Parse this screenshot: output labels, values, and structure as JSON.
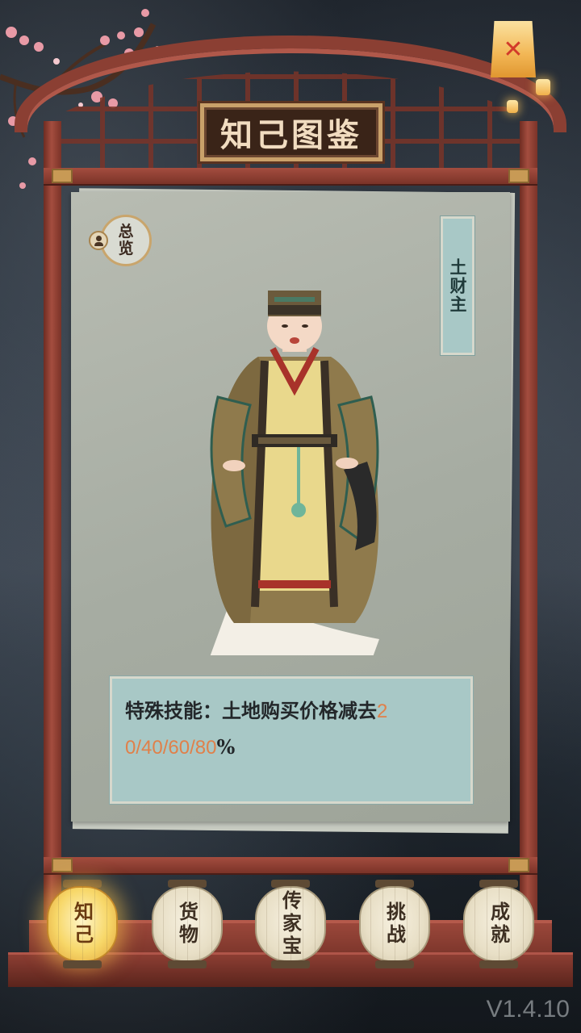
{
  "header": {
    "title": "知己图鉴"
  },
  "overview": {
    "label": "总览"
  },
  "character": {
    "name": "土财主"
  },
  "skill": {
    "line1_text": "特殊技能：土地购买价格减去",
    "line1_num": "2",
    "line2_num": "0/40/60/80",
    "line2_suffix": "%"
  },
  "tabs": [
    {
      "label": "知己",
      "active": true
    },
    {
      "label": "货物",
      "active": false
    },
    {
      "label": "传家宝",
      "active": false
    },
    {
      "label": "挑战",
      "active": false
    },
    {
      "label": "成就",
      "active": false
    }
  ],
  "version": "V1.4.10",
  "colors": {
    "frame": "#8b3f33",
    "paper": "#a6aca2",
    "accent_teal": "#a8c8c6",
    "highlight_number": "#e0804a",
    "active_lantern": "#f7d768"
  },
  "icons": {
    "close": "close-lantern-icon",
    "overview": "person-icon"
  }
}
